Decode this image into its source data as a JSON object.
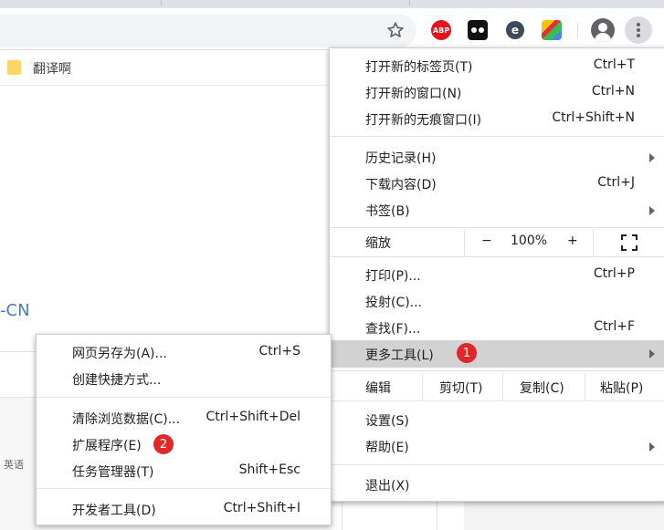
{
  "toolbar": {
    "extensions": [
      "bookmark-star-icon",
      "adblock-plus-icon",
      "tampermonkey-icon",
      "e-extension-icon",
      "color-extension-icon"
    ],
    "abp_label": "ABP",
    "profile_icon": "account-circle-icon",
    "menu_icon": "three-dots-vertical-icon"
  },
  "bookmarks": {
    "folder_label": "翻译啊"
  },
  "page": {
    "partial_text": "-CN",
    "lang_label": "英语"
  },
  "main_menu": {
    "new_tab": {
      "label": "打开新的标签页(T)",
      "shortcut": "Ctrl+T"
    },
    "new_window": {
      "label": "打开新的窗口(N)",
      "shortcut": "Ctrl+N"
    },
    "incognito": {
      "label": "打开新的无痕窗口(I)",
      "shortcut": "Ctrl+Shift+N"
    },
    "history": {
      "label": "历史记录(H)"
    },
    "downloads": {
      "label": "下载内容(D)",
      "shortcut": "Ctrl+J"
    },
    "bookmarks": {
      "label": "书签(B)"
    },
    "zoom": {
      "label": "缩放",
      "minus": "−",
      "level": "100%",
      "plus": "+"
    },
    "print": {
      "label": "打印(P)...",
      "shortcut": "Ctrl+P"
    },
    "cast": {
      "label": "投射(C)..."
    },
    "find": {
      "label": "查找(F)...",
      "shortcut": "Ctrl+F"
    },
    "more_tools": {
      "label": "更多工具(L)",
      "badge": "1"
    },
    "edit": {
      "label": "编辑",
      "cut": "剪切(T)",
      "copy": "复制(C)",
      "paste": "粘贴(P)"
    },
    "settings": {
      "label": "设置(S)"
    },
    "help": {
      "label": "帮助(E)"
    },
    "exit": {
      "label": "退出(X)"
    }
  },
  "sub_menu": {
    "save_page": {
      "label": "网页另存为(A)...",
      "shortcut": "Ctrl+S"
    },
    "create_shortcut": {
      "label": "创建快捷方式..."
    },
    "clear_data": {
      "label": "清除浏览数据(C)...",
      "shortcut": "Ctrl+Shift+Del"
    },
    "extensions": {
      "label": "扩展程序(E)",
      "badge": "2"
    },
    "task_manager": {
      "label": "任务管理器(T)",
      "shortcut": "Shift+Esc"
    },
    "devtools": {
      "label": "开发者工具(D)",
      "shortcut": "Ctrl+Shift+I"
    }
  },
  "colors": {
    "highlight": "#d2d2d2",
    "badge": "#e02828",
    "abp": "#e4141c"
  }
}
